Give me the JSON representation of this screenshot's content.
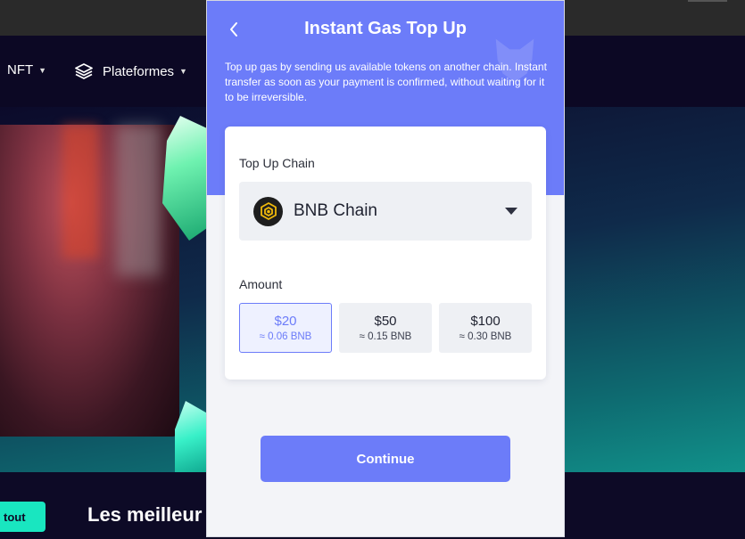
{
  "background": {
    "nav": [
      {
        "label": "NFT",
        "icon": "chevron-down-icon"
      },
      {
        "label": "Plateformes",
        "icon": "layers-icon"
      }
    ],
    "tag_label": "tout",
    "heading": "Les meilleur"
  },
  "modal": {
    "title": "Instant Gas Top Up",
    "description": "Top up gas by sending us available tokens on another chain. Instant transfer as soon as your payment is confirmed, without waiting for it to be irreversible.",
    "accent_color": "#6c7cf9",
    "chain": {
      "label": "Top Up Chain",
      "selected": "BNB Chain",
      "logo": "bnb-chain-logo"
    },
    "amount": {
      "label": "Amount",
      "options": [
        {
          "usd": "$20",
          "bnb": "≈ 0.06 BNB",
          "selected": true
        },
        {
          "usd": "$50",
          "bnb": "≈ 0.15 BNB",
          "selected": false
        },
        {
          "usd": "$100",
          "bnb": "≈ 0.30 BNB",
          "selected": false
        }
      ]
    },
    "continue_label": "Continue"
  }
}
